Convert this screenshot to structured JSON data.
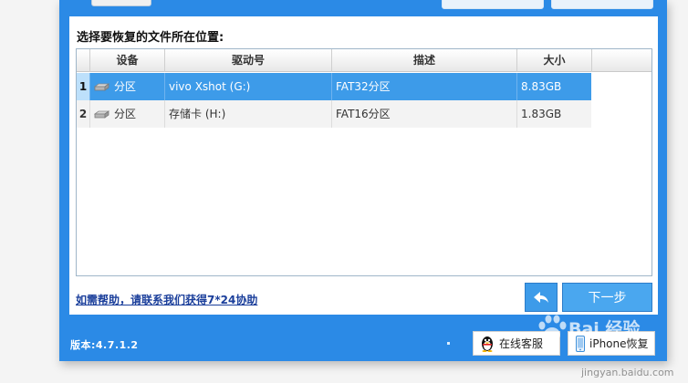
{
  "panel": {
    "title": "选择要恢复的文件所在位置:"
  },
  "table": {
    "columns": {
      "device": "设备",
      "drive": "驱动号",
      "description": "描述",
      "size": "大小"
    },
    "rows": [
      {
        "index": "1",
        "device": "分区",
        "drive": "vivo Xshot (G:)",
        "description": "FAT32分区",
        "size": "8.83GB",
        "selected": true
      },
      {
        "index": "2",
        "device": "分区",
        "drive": "存储卡 (H:)",
        "description": "FAT16分区",
        "size": "1.83GB",
        "selected": false
      }
    ]
  },
  "footer": {
    "help_link": "如需帮助，请联系我们获得7*24协助",
    "back_icon": "back-arrow-icon",
    "next_label": "下一步",
    "version": "版本:4.7.1.2",
    "qq_label": "在线客服",
    "iphone_label": "iPhone恢复"
  },
  "watermark": {
    "main": "Bai 经验",
    "sub": "jingyan.baidu.com"
  },
  "colors": {
    "window_blue": "#2b8ae6",
    "selected_row": "#3d9be9",
    "link": "#1b3f9b"
  }
}
